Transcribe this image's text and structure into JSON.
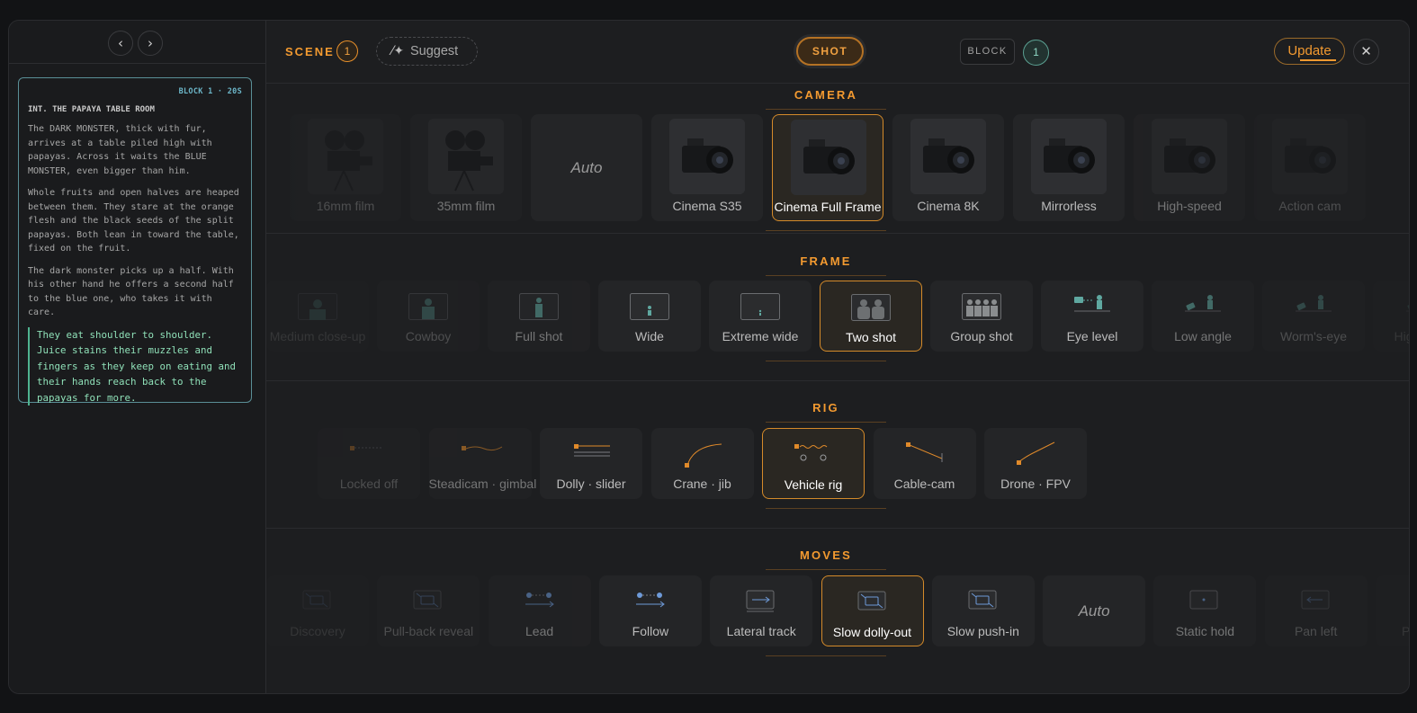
{
  "sidebar": {
    "prev_icon": "chevron-left-icon",
    "next_icon": "chevron-right-icon",
    "script": {
      "block_tag": "BLOCK 1 · 20S",
      "slug": "INT. THE PAPAYA TABLE ROOM",
      "paragraphs": [
        "The DARK MONSTER, thick with fur, arrives at a table piled high with papayas. Across it waits the BLUE MONSTER, even bigger than him.",
        "Whole fruits and open halves are heaped between them. They stare at the orange flesh and the black seeds of the split papayas. Both lean in toward the table, fixed on the fruit.",
        "The dark monster picks up a half. With his other hand he offers a second half to the blue one, who takes it with care."
      ],
      "highlight": "They eat shoulder to shoulder. Juice stains their muzzles and fingers as they keep on eating and their hands reach back to the papayas for more."
    }
  },
  "header": {
    "scene_label": "SCENE",
    "scene_number": "1",
    "suggest_label": "Suggest",
    "shot_label": "SHOT",
    "block_label": "BLOCK",
    "block_number": "1",
    "update_label": "Update",
    "close_icon": "close-icon"
  },
  "camera": {
    "title": "CAMERA",
    "options": [
      {
        "label": "16mm film",
        "state": "dim2"
      },
      {
        "label": "35mm film",
        "state": "dim1"
      },
      {
        "label": "Auto",
        "auto": true,
        "state": "normal"
      },
      {
        "label": "Cinema S35",
        "state": "normal"
      },
      {
        "label": "Cinema Full Frame",
        "state": "selected"
      },
      {
        "label": "Cinema 8K",
        "state": "normal"
      },
      {
        "label": "Mirrorless",
        "state": "normal"
      },
      {
        "label": "High-speed",
        "state": "dim1"
      },
      {
        "label": "Action cam",
        "state": "dim2"
      }
    ]
  },
  "frame": {
    "title": "FRAME",
    "options": [
      {
        "label": "Medium close-up",
        "state": "dim3"
      },
      {
        "label": "Cowboy",
        "state": "dim2"
      },
      {
        "label": "Full shot",
        "state": "dim1"
      },
      {
        "label": "Wide",
        "state": "normal"
      },
      {
        "label": "Extreme wide",
        "state": "normal"
      },
      {
        "label": "Two shot",
        "state": "selected"
      },
      {
        "label": "Group shot",
        "state": "normal"
      },
      {
        "label": "Eye level",
        "state": "normal"
      },
      {
        "label": "Low angle",
        "state": "dim1"
      },
      {
        "label": "Worm's-eye",
        "state": "dim2"
      },
      {
        "label": "High angle",
        "state": "dim3"
      }
    ]
  },
  "rig": {
    "title": "RIG",
    "options": [
      {
        "label": "Locked off",
        "state": "dim2"
      },
      {
        "label": "Steadicam · gimbal",
        "state": "dim1"
      },
      {
        "label": "Dolly · slider",
        "state": "normal"
      },
      {
        "label": "Crane · jib",
        "state": "normal"
      },
      {
        "label": "Vehicle rig",
        "state": "selected"
      },
      {
        "label": "Cable-cam",
        "state": "normal"
      },
      {
        "label": "Drone · FPV",
        "state": "normal"
      }
    ]
  },
  "moves": {
    "title": "MOVES",
    "options": [
      {
        "label": "Discovery",
        "state": "dim3"
      },
      {
        "label": "Pull-back reveal",
        "state": "dim2"
      },
      {
        "label": "Lead",
        "state": "dim1"
      },
      {
        "label": "Follow",
        "state": "normal"
      },
      {
        "label": "Lateral track",
        "state": "normal"
      },
      {
        "label": "Slow dolly-out",
        "state": "selected"
      },
      {
        "label": "Slow push-in",
        "state": "normal"
      },
      {
        "label": "Auto",
        "auto": true,
        "state": "normal"
      },
      {
        "label": "Static hold",
        "state": "dim1"
      },
      {
        "label": "Pan left",
        "state": "dim2"
      },
      {
        "label": "Pan right",
        "state": "dim3"
      }
    ]
  },
  "colors": {
    "accent": "#f39a30",
    "teal": "#6cb6c8",
    "highlight_text": "#8fe0b8"
  }
}
